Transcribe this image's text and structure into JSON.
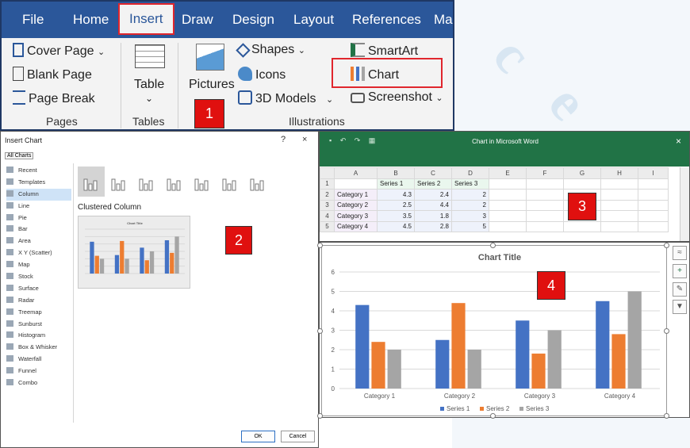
{
  "ribbon": {
    "tabs": [
      "File",
      "Home",
      "Insert",
      "Draw",
      "Design",
      "Layout",
      "References",
      "Mai"
    ],
    "active_tab": "Insert",
    "pages": {
      "cover_page": "Cover Page",
      "blank_page": "Blank Page",
      "page_break": "Page Break",
      "label": "Pages"
    },
    "tables": {
      "table": "Table",
      "label": "Tables"
    },
    "illustrations": {
      "pictures": "Pictures",
      "shapes": "Shapes",
      "icons": "Icons",
      "models": "3D Models",
      "smartart": "SmartArt",
      "chart": "Chart",
      "screenshot": "Screenshot",
      "label": "Illustrations"
    }
  },
  "steps": [
    "1",
    "2",
    "3",
    "4"
  ],
  "dialog": {
    "title": "Insert Chart",
    "help": "?",
    "close": "×",
    "tab": "All Charts",
    "chart_types": [
      "Recent",
      "Templates",
      "Column",
      "Line",
      "Pie",
      "Bar",
      "Area",
      "X Y (Scatter)",
      "Map",
      "Stock",
      "Surface",
      "Radar",
      "Treemap",
      "Sunburst",
      "Histogram",
      "Box & Whisker",
      "Waterfall",
      "Funnel",
      "Combo"
    ],
    "selected_type": "Column",
    "subtype_label": "Clustered Column",
    "preview_title": "Chart Title",
    "ok": "OK",
    "cancel": "Cancel"
  },
  "excel": {
    "title": "Chart in Microsoft Word",
    "close": "×",
    "columns": [
      "A",
      "B",
      "C",
      "D",
      "E",
      "F",
      "G",
      "H",
      "I"
    ],
    "header_row": [
      "",
      "Series 1",
      "Series 2",
      "Series 3"
    ],
    "rows": [
      [
        "Category 1",
        "4.3",
        "2.4",
        "2"
      ],
      [
        "Category 2",
        "2.5",
        "4.4",
        "2"
      ],
      [
        "Category 3",
        "3.5",
        "1.8",
        "3"
      ],
      [
        "Category 4",
        "4.5",
        "2.8",
        "5"
      ]
    ]
  },
  "colors": {
    "series1": "#4472c4",
    "series2": "#ed7d31",
    "series3": "#a5a5a5",
    "ribbon": "#2b579a",
    "excel": "#217346",
    "highlight": "#e0262d"
  },
  "chart_data": {
    "type": "bar",
    "title": "Chart Title",
    "categories": [
      "Category 1",
      "Category 2",
      "Category 3",
      "Category 4"
    ],
    "series": [
      {
        "name": "Series 1",
        "values": [
          4.3,
          2.5,
          3.5,
          4.5
        ]
      },
      {
        "name": "Series 2",
        "values": [
          2.4,
          4.4,
          1.8,
          2.8
        ]
      },
      {
        "name": "Series 3",
        "values": [
          2,
          2,
          3,
          5
        ]
      }
    ],
    "ylim": [
      0,
      6
    ],
    "yticks": [
      "0",
      "1",
      "2",
      "3",
      "4",
      "5",
      "6"
    ],
    "grid": true,
    "legend_position": "bottom"
  }
}
